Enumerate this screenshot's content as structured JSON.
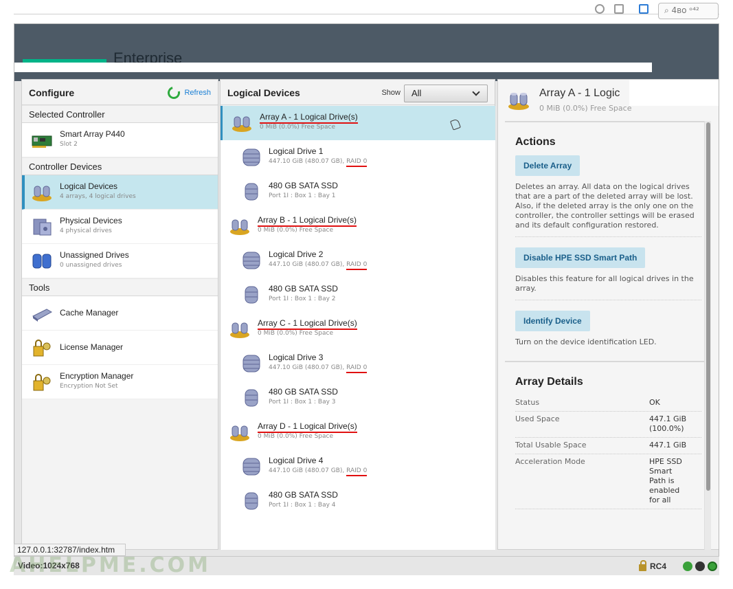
{
  "brand": {
    "text": "Enterprise",
    "green": "#00b388"
  },
  "top": {
    "box_text": "⌕ 4ʙᴏ ᵒ⁴²"
  },
  "left_panel": {
    "title": "Configure",
    "refresh_label": "Refresh",
    "sections": [
      {
        "heading": "Selected Controller",
        "items": [
          {
            "name": "Smart Array P440",
            "sub": "Slot 2",
            "icon": "controller-card-icon",
            "selected": false
          }
        ]
      },
      {
        "heading": "Controller Devices",
        "items": [
          {
            "name": "Logical Devices",
            "sub": "4 arrays, 4 logical drives",
            "icon": "logical-devices-icon",
            "selected": true
          },
          {
            "name": "Physical Devices",
            "sub": "4 physical drives",
            "icon": "physical-devices-icon",
            "selected": false
          },
          {
            "name": "Unassigned Drives",
            "sub": "0 unassigned drives",
            "icon": "unassigned-drives-icon",
            "selected": false
          }
        ]
      },
      {
        "heading": "Tools",
        "items": [
          {
            "name": "Cache Manager",
            "sub": "",
            "icon": "cache-manager-icon",
            "selected": false
          },
          {
            "name": "License Manager",
            "sub": "",
            "icon": "license-manager-icon",
            "selected": false
          },
          {
            "name": "Encryption Manager",
            "sub": "Encryption Not Set",
            "icon": "encryption-manager-icon",
            "selected": false
          }
        ]
      }
    ]
  },
  "middle_panel": {
    "title": "Logical Devices",
    "show_label": "Show",
    "show_value": "All",
    "rows": [
      {
        "kind": "array",
        "name": "Array A - 1 Logical Drive(s)",
        "sub": "0 MiB (0.0%) Free Space",
        "selected": true
      },
      {
        "kind": "logical",
        "name": "Logical Drive 1",
        "sub": "447.10 GiB (480.07 GB), ",
        "raid": "RAID 0"
      },
      {
        "kind": "ssd",
        "name": "480 GB SATA SSD",
        "sub": "Port 1I : Box 1 : Bay 1"
      },
      {
        "kind": "array",
        "name": "Array B - 1 Logical Drive(s)",
        "sub": "0 MiB (0.0%) Free Space",
        "selected": false
      },
      {
        "kind": "logical",
        "name": "Logical Drive 2",
        "sub": "447.10 GiB (480.07 GB), ",
        "raid": "RAID 0"
      },
      {
        "kind": "ssd",
        "name": "480 GB SATA SSD",
        "sub": "Port 1I : Box 1 : Bay 2"
      },
      {
        "kind": "array",
        "name": "Array C - 1 Logical Drive(s)",
        "sub": "0 MiB (0.0%) Free Space",
        "selected": false
      },
      {
        "kind": "logical",
        "name": "Logical Drive 3",
        "sub": "447.10 GiB (480.07 GB), ",
        "raid": "RAID 0"
      },
      {
        "kind": "ssd",
        "name": "480 GB SATA SSD",
        "sub": "Port 1I : Box 1 : Bay 3"
      },
      {
        "kind": "array",
        "name": "Array D - 1 Logical Drive(s)",
        "sub": "0 MiB (0.0%) Free Space",
        "selected": false
      },
      {
        "kind": "logical",
        "name": "Logical Drive 4",
        "sub": "447.10 GiB (480.07 GB), ",
        "raid": "RAID 0"
      },
      {
        "kind": "ssd",
        "name": "480 GB SATA SSD",
        "sub": "Port 1I : Box 1 : Bay 4"
      }
    ]
  },
  "right_panel": {
    "title": "Array A - 1 Logic",
    "subtitle": "0 MiB (0.0%) Free Space",
    "actions_heading": "Actions",
    "actions": [
      {
        "label": "Delete Array",
        "desc": "Deletes an array. All data on the logical drives that are a part of the deleted array will be lost. Also, if the deleted array is the only one on the controller, the controller settings will be erased and its default configuration restored."
      },
      {
        "label": "Disable HPE SSD Smart Path",
        "desc": "Disables this feature for all logical drives in the array."
      },
      {
        "label": "Identify Device",
        "desc": "Turn on the device identification LED."
      }
    ],
    "details_heading": "Array Details",
    "details": [
      {
        "key": "Status",
        "value": "OK"
      },
      {
        "key": "Used Space",
        "value": "447.1 GiB (100.0%)"
      },
      {
        "key": "Total Usable Space",
        "value": "447.1 GiB"
      },
      {
        "key": "Acceleration Mode",
        "value": "HPE SSD Smart Path is enabled for all"
      }
    ]
  },
  "status": {
    "url": "127.0.0.1:32787/index.htm",
    "video": "Video:1024x768",
    "watermark": "AHELPME.COM",
    "rc4": "RC4"
  },
  "colors": {
    "selected_bg": "#c5e6ee",
    "accent_blue": "#2f8fbf",
    "button_bg": "#c8e3ee",
    "header_bar": "#4d5a66",
    "underline_red": "#e01010"
  }
}
